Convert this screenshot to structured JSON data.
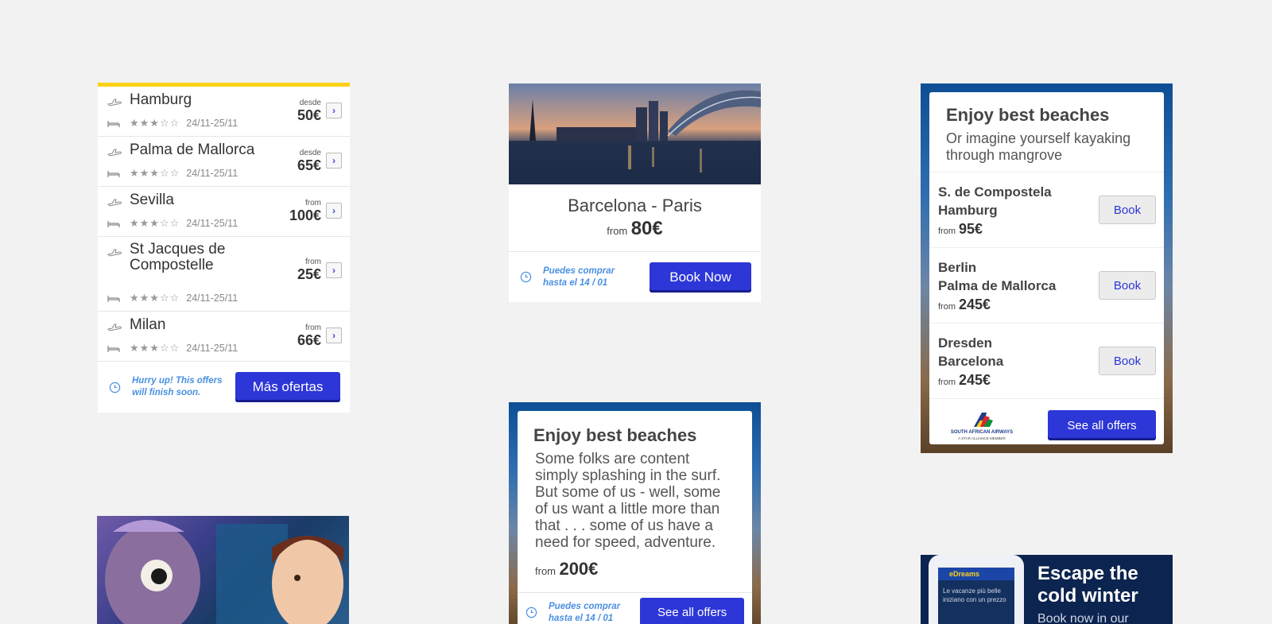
{
  "list_card": {
    "offers": [
      {
        "city": "Hamburg",
        "dates": "24/11-25/11",
        "from": "desde",
        "price": "50€"
      },
      {
        "city": "Palma de Mallorca",
        "dates": "24/11-25/11",
        "from": "desde",
        "price": "65€"
      },
      {
        "city": "Sevilla",
        "dates": "24/11-25/11",
        "from": "from",
        "price": "100€"
      },
      {
        "city": "St Jacques de Compostelle",
        "dates": "24/11-25/11",
        "from": "from",
        "price": "25€"
      },
      {
        "city": "Milan",
        "dates": "24/11-25/11",
        "from": "from",
        "price": "66€"
      }
    ],
    "rating": "★★★☆☆",
    "hurry_text": "Hurry up! This offers will finish soon.",
    "more_button": "Más ofertas",
    "chevron": "›"
  },
  "route_card": {
    "title": "Barcelona - Paris",
    "from": "from",
    "price": "80€",
    "buy_until": "Puedes comprar hasta el 14 / 01",
    "book_button": "Book Now"
  },
  "beaches_right": {
    "title": "Enjoy best beaches",
    "subtitle": "Or imagine yourself kayaking through mangrove",
    "routes": [
      {
        "origin": "S. de Compostela",
        "destination": "Hamburg",
        "from": "from",
        "price": "95€",
        "button": "Book"
      },
      {
        "origin": "Berlin",
        "destination": "Palma de Mallorca",
        "from": "from",
        "price": "245€",
        "button": "Book"
      },
      {
        "origin": "Dresden",
        "destination": "Barcelona",
        "from": "from",
        "price": "245€",
        "button": "Book"
      }
    ],
    "logo_name": "SOUTH AFRICAN AIRWAYS",
    "logo_tagline": "A STAR ALLIANCE MEMBER",
    "see_all_button": "See all offers"
  },
  "beaches_mid": {
    "title": "Enjoy best beaches",
    "text": "Some folks are content simply splashing in the surf. But some of us - well, some of us want a little more than that . . . some of us have a need for speed, adventure.",
    "from": "from",
    "price": "200€",
    "buy_until": "Puedes comprar hasta el 14 / 01",
    "see_all_button": "See all offers"
  },
  "winter_card": {
    "title": "Escape the cold winter",
    "subtitle": "Book now in our",
    "phone_brand": "eDreams",
    "phone_text": "Le vacanze più belle iniziano con un prezzo"
  },
  "colors": {
    "accent_yellow": "#fcd118",
    "primary_blue": "#2d36d6",
    "link_blue": "#4a90e2",
    "background": "#f2f2f2"
  }
}
